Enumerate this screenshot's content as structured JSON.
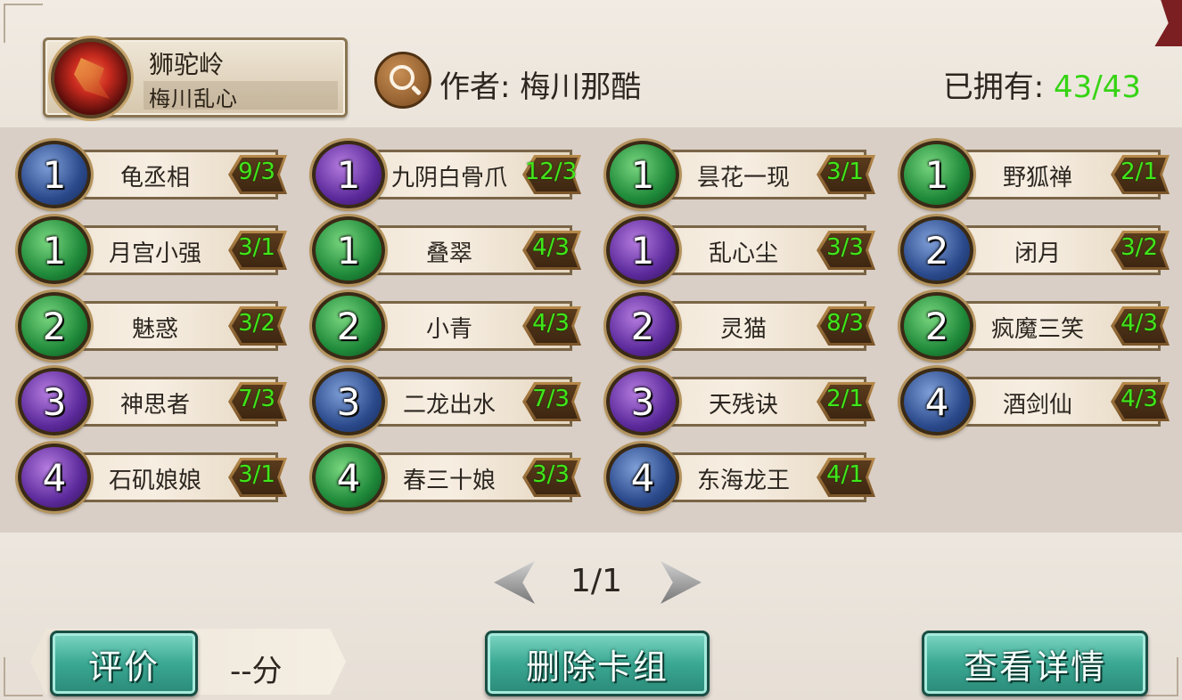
{
  "deck": {
    "name": "狮驼岭",
    "subtitle": "梅川乱心",
    "author": "作者: 梅川那酷",
    "owned_label": "已拥有: ",
    "owned_value": "43/43"
  },
  "cards": [
    {
      "cost": "1",
      "color": "blue",
      "name": "龟丞相",
      "count": "9/3"
    },
    {
      "cost": "1",
      "color": "purple",
      "name": "九阴白骨爪",
      "count": "12/3"
    },
    {
      "cost": "1",
      "color": "green",
      "name": "昙花一现",
      "count": "3/1"
    },
    {
      "cost": "1",
      "color": "green",
      "name": "野狐禅",
      "count": "2/1"
    },
    {
      "cost": "1",
      "color": "green",
      "name": "月宫小强",
      "count": "3/1"
    },
    {
      "cost": "1",
      "color": "green",
      "name": "叠翠",
      "count": "4/3"
    },
    {
      "cost": "1",
      "color": "purple",
      "name": "乱心尘",
      "count": "3/3"
    },
    {
      "cost": "2",
      "color": "blue",
      "name": "闭月",
      "count": "3/2"
    },
    {
      "cost": "2",
      "color": "green",
      "name": "魅惑",
      "count": "3/2"
    },
    {
      "cost": "2",
      "color": "green",
      "name": "小青",
      "count": "4/3"
    },
    {
      "cost": "2",
      "color": "purple",
      "name": "灵猫",
      "count": "8/3"
    },
    {
      "cost": "2",
      "color": "green",
      "name": "疯魔三笑",
      "count": "4/3"
    },
    {
      "cost": "3",
      "color": "purple",
      "name": "神思者",
      "count": "7/3"
    },
    {
      "cost": "3",
      "color": "blue",
      "name": "二龙出水",
      "count": "7/3"
    },
    {
      "cost": "3",
      "color": "purple",
      "name": "天残诀",
      "count": "2/1"
    },
    {
      "cost": "4",
      "color": "blue",
      "name": "酒剑仙",
      "count": "4/3"
    },
    {
      "cost": "4",
      "color": "purple",
      "name": "石矶娘娘",
      "count": "3/1"
    },
    {
      "cost": "4",
      "color": "green",
      "name": "春三十娘",
      "count": "3/3"
    },
    {
      "cost": "4",
      "color": "blue",
      "name": "东海龙王",
      "count": "4/1"
    }
  ],
  "pager": {
    "page": "1/1"
  },
  "footer": {
    "rate_label": "评价",
    "score": "--分",
    "delete_label": "删除卡组",
    "detail_label": "查看详情"
  },
  "colors": {
    "blue": "#2b4a8c",
    "purple": "#5c2a9b",
    "green": "#1f8a3a",
    "count_text": "#41e61a",
    "owned_value": "#36d414"
  }
}
